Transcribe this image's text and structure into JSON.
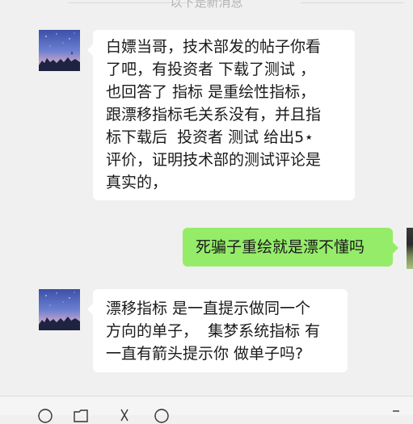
{
  "divider": {
    "text": "以下是新消息"
  },
  "messages": [
    {
      "side": "left",
      "avatar_icon": "night-sky-avatar-icon",
      "text": "白嫖当哥，技术部发的帖子你看\n了吧，有投资者 下载了测试 ，\n也回答了 指标 是重绘性指标，\n跟漂移指标毛关系没有，并且指\n标下载后  投资者 测试 给出5⋆\n评价，证明技术部的测试评论是\n真实的，"
    },
    {
      "side": "right",
      "avatar_icon": "user-avatar-icon",
      "text": "死骗子重绘就是漂不懂吗"
    },
    {
      "side": "left",
      "avatar_icon": "night-sky-avatar-icon",
      "text": "漂移指标 是一直提示做同一个\n方向的单子，  集梦系统指标 有\n一直有箭头提示你 做单子吗?"
    }
  ],
  "toolbar": {
    "icons": [
      "emoji-icon",
      "folder-icon",
      "scissors-icon",
      "chat-bubble-icon"
    ]
  },
  "colors": {
    "background": "#f0f0f0",
    "bubble_left": "#ffffff",
    "bubble_right": "#95ec69",
    "divider_text": "#b3b3b3"
  }
}
